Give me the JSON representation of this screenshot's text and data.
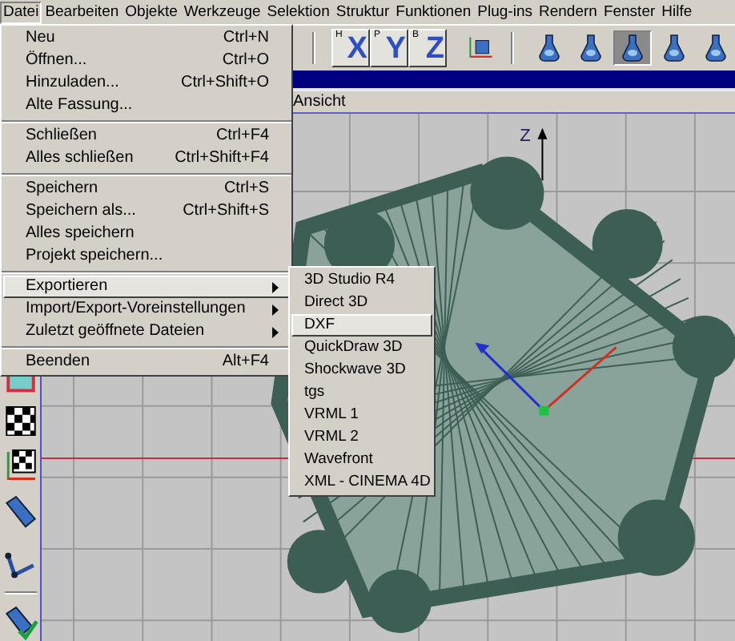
{
  "menubar": [
    {
      "label": "Datei",
      "selected": true
    },
    {
      "label": "Bearbeiten",
      "selected": false
    },
    {
      "label": "Objekte",
      "selected": false
    },
    {
      "label": "Werkzeuge",
      "selected": false
    },
    {
      "label": "Selektion",
      "selected": false
    },
    {
      "label": "Struktur",
      "selected": false
    },
    {
      "label": "Funktionen",
      "selected": false
    },
    {
      "label": "Plug-ins",
      "selected": false
    },
    {
      "label": "Rendern",
      "selected": false
    },
    {
      "label": "Fenster",
      "selected": false
    },
    {
      "label": "Hilfe",
      "selected": false
    }
  ],
  "toolbar": {
    "axis_buttons": [
      {
        "label": "X",
        "sub": "H"
      },
      {
        "label": "Y",
        "sub": "P"
      },
      {
        "label": "Z",
        "sub": "B"
      }
    ],
    "render_buttons": [
      {
        "pressed": false
      },
      {
        "pressed": false
      },
      {
        "pressed": true
      },
      {
        "pressed": false
      },
      {
        "pressed": false
      }
    ]
  },
  "viewport": {
    "menu": "Ansicht",
    "axis_label": "Z"
  },
  "file_menu": [
    [
      {
        "label": "Neu",
        "shortcut": "Ctrl+N",
        "submenu": false,
        "selected": false
      },
      {
        "label": "Öffnen...",
        "shortcut": "Ctrl+O",
        "submenu": false,
        "selected": false
      },
      {
        "label": "Hinzuladen...",
        "shortcut": "Ctrl+Shift+O",
        "submenu": false,
        "selected": false
      },
      {
        "label": "Alte Fassung...",
        "submenu": false,
        "selected": false
      }
    ],
    [
      {
        "label": "Schließen",
        "shortcut": "Ctrl+F4",
        "submenu": false,
        "selected": false
      },
      {
        "label": "Alles schließen",
        "shortcut": "Ctrl+Shift+F4",
        "submenu": false,
        "selected": false
      }
    ],
    [
      {
        "label": "Speichern",
        "shortcut": "Ctrl+S",
        "submenu": false,
        "selected": false
      },
      {
        "label": "Speichern als...",
        "shortcut": "Ctrl+Shift+S",
        "submenu": false,
        "selected": false
      },
      {
        "label": "Alles speichern",
        "submenu": false,
        "selected": false
      },
      {
        "label": "Projekt speichern...",
        "submenu": false,
        "selected": false
      }
    ],
    [
      {
        "label": "Exportieren",
        "submenu": true,
        "selected": true
      },
      {
        "label": "Import/Export-Voreinstellungen",
        "submenu": true,
        "selected": false
      },
      {
        "label": "Zuletzt geöffnete Dateien",
        "submenu": true,
        "selected": false
      }
    ],
    [
      {
        "label": "Beenden",
        "shortcut": "Alt+F4",
        "submenu": false,
        "selected": false
      }
    ]
  ],
  "export_submenu": [
    {
      "label": "3D Studio R4",
      "selected": false
    },
    {
      "label": "Direct 3D",
      "selected": false
    },
    {
      "label": "DXF",
      "selected": true
    },
    {
      "label": "QuickDraw 3D",
      "selected": false
    },
    {
      "label": "Shockwave 3D",
      "selected": false
    },
    {
      "label": "tgs",
      "selected": false
    },
    {
      "label": "VRML 1",
      "selected": false
    },
    {
      "label": "VRML 2",
      "selected": false
    },
    {
      "label": "Wavefront",
      "selected": false
    },
    {
      "label": "XML - CINEMA 4D",
      "selected": false
    }
  ]
}
